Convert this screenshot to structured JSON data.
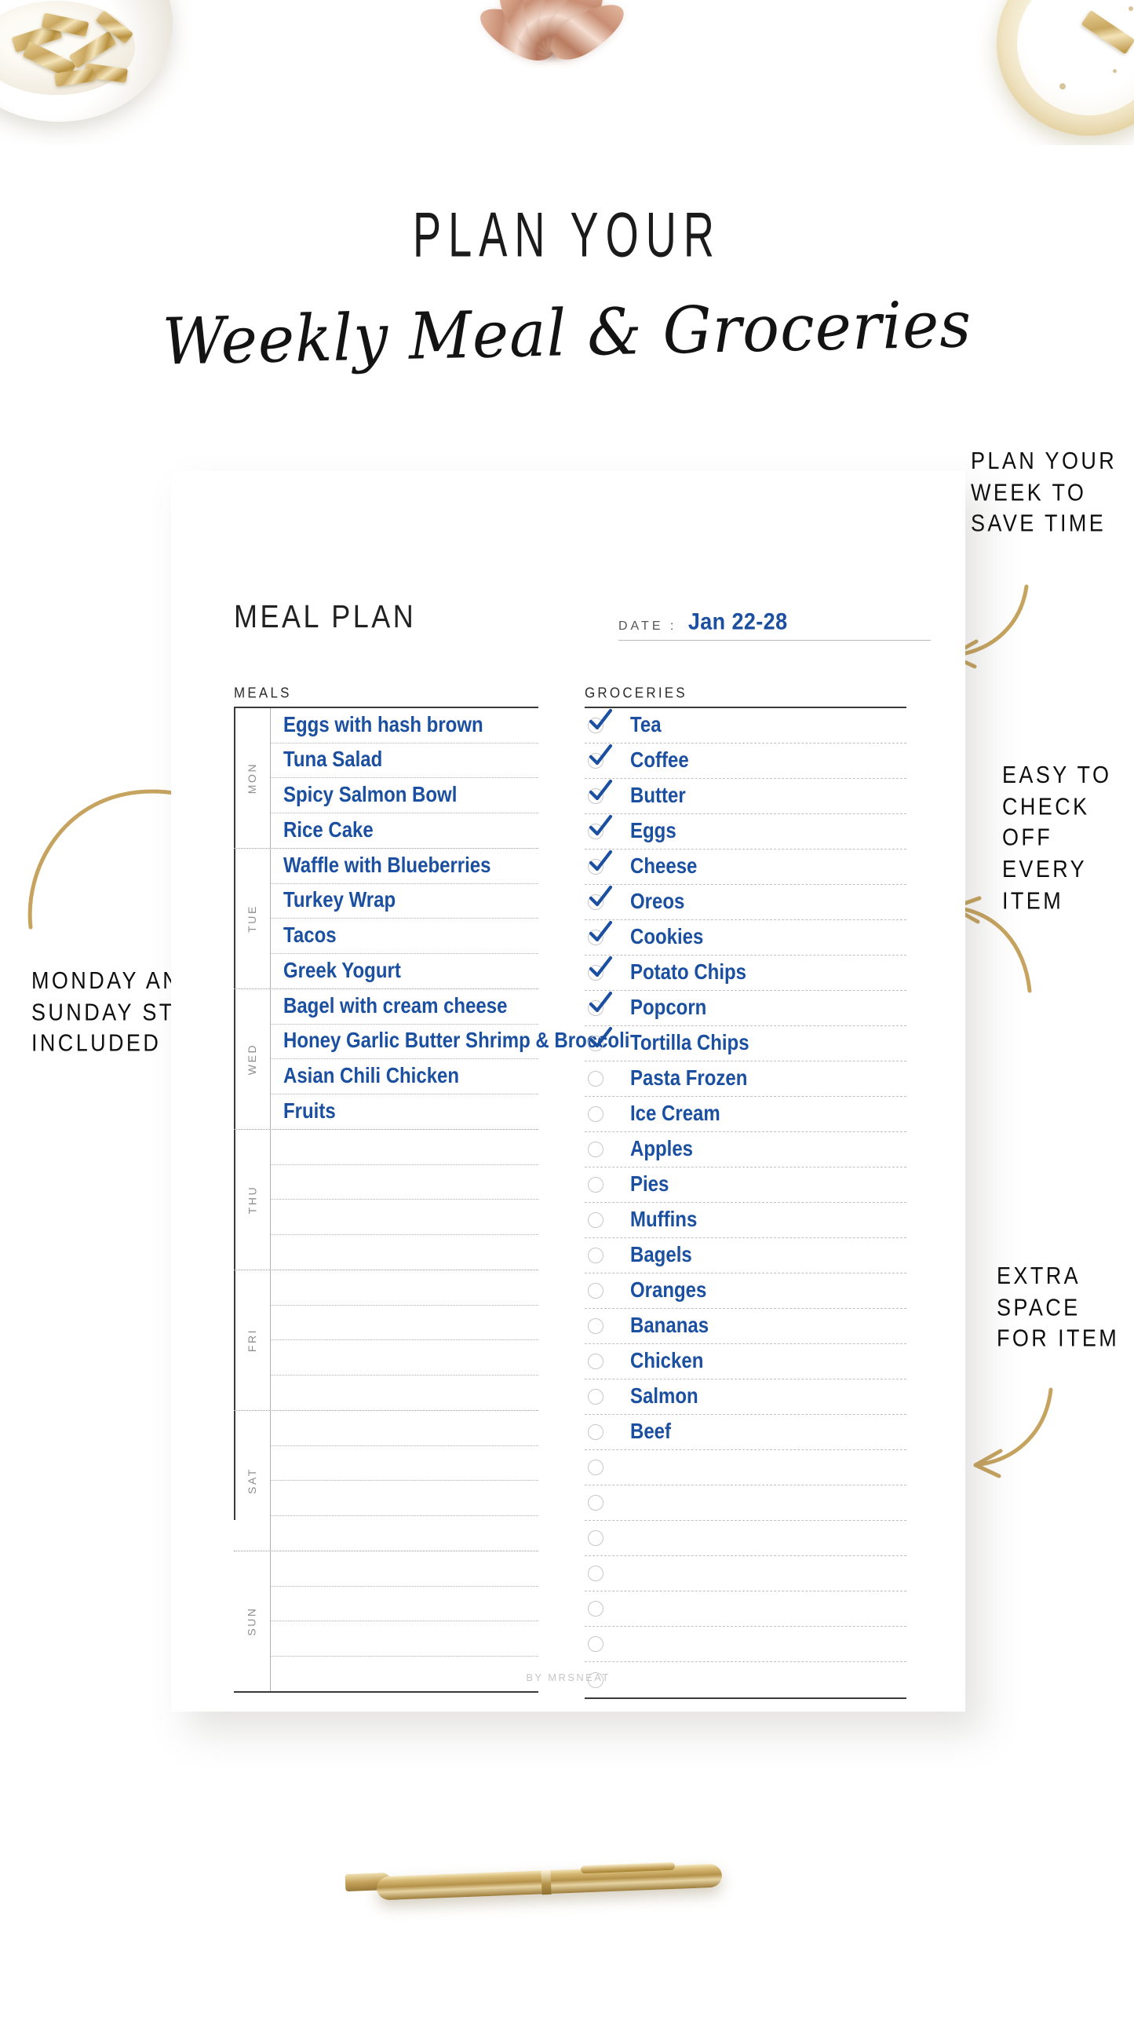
{
  "header": {
    "title": "PLAN YOUR",
    "subtitle": "Weekly Meal & Groceries"
  },
  "sheet": {
    "page_title": "MEAL PLAN",
    "date_label": "DATE :",
    "date_value": "Jan 22-28",
    "meals_heading": "MEALS",
    "groceries_heading": "GROCERIES",
    "footer_credit": "BY MRSNEAT"
  },
  "meal_plan": {
    "days": [
      {
        "day": "MON",
        "meals": [
          "Eggs with hash brown",
          "Tuna Salad",
          "Spicy Salmon Bowl",
          "Rice Cake"
        ]
      },
      {
        "day": "TUE",
        "meals": [
          "Waffle with Blueberries",
          "Turkey Wrap",
          "Tacos",
          "Greek Yogurt"
        ]
      },
      {
        "day": "WED",
        "meals": [
          "Bagel with cream cheese",
          "Honey Garlic Butter Shrimp & Broccoli",
          "Asian Chili Chicken",
          "Fruits"
        ]
      },
      {
        "day": "THU",
        "meals": [
          "",
          "",
          "",
          ""
        ]
      },
      {
        "day": "FRI",
        "meals": [
          "",
          "",
          "",
          ""
        ]
      },
      {
        "day": "SAT",
        "meals": [
          "",
          "",
          "",
          ""
        ]
      },
      {
        "day": "SUN",
        "meals": [
          "",
          "",
          "",
          ""
        ]
      }
    ]
  },
  "groceries": {
    "items": [
      {
        "label": "Tea",
        "checked": true
      },
      {
        "label": "Coffee",
        "checked": true
      },
      {
        "label": "Butter",
        "checked": true
      },
      {
        "label": "Eggs",
        "checked": true
      },
      {
        "label": "Cheese",
        "checked": true
      },
      {
        "label": "Oreos",
        "checked": true
      },
      {
        "label": "Cookies",
        "checked": true
      },
      {
        "label": "Potato Chips",
        "checked": true
      },
      {
        "label": "Popcorn",
        "checked": true
      },
      {
        "label": "Tortilla Chips",
        "checked": true
      },
      {
        "label": "Pasta Frozen",
        "checked": false
      },
      {
        "label": "Ice Cream",
        "checked": false
      },
      {
        "label": "Apples",
        "checked": false
      },
      {
        "label": "Pies",
        "checked": false
      },
      {
        "label": "Muffins",
        "checked": false
      },
      {
        "label": "Bagels",
        "checked": false
      },
      {
        "label": "Oranges",
        "checked": false
      },
      {
        "label": "Bananas",
        "checked": false
      },
      {
        "label": "Chicken",
        "checked": false
      },
      {
        "label": "Salmon",
        "checked": false
      },
      {
        "label": "Beef",
        "checked": false
      },
      {
        "label": "",
        "checked": false
      },
      {
        "label": "",
        "checked": false
      },
      {
        "label": "",
        "checked": false
      },
      {
        "label": "",
        "checked": false
      },
      {
        "label": "",
        "checked": false
      },
      {
        "label": "",
        "checked": false
      },
      {
        "label": "",
        "checked": false
      }
    ]
  },
  "callouts": {
    "plan_week": "PLAN YOUR WEEK TO SAVE TIME",
    "easy_check": "EASY TO CHECK OFF EVERY ITEM",
    "extra_space": "EXTRA SPACE FOR ITEM",
    "monday_sunday": "MONDAY AND SUNDAY START INCLUDED"
  },
  "colors": {
    "accent_blue": "#1b4fa0",
    "gold": "#c9a760",
    "rule": "#3a3a3a"
  }
}
